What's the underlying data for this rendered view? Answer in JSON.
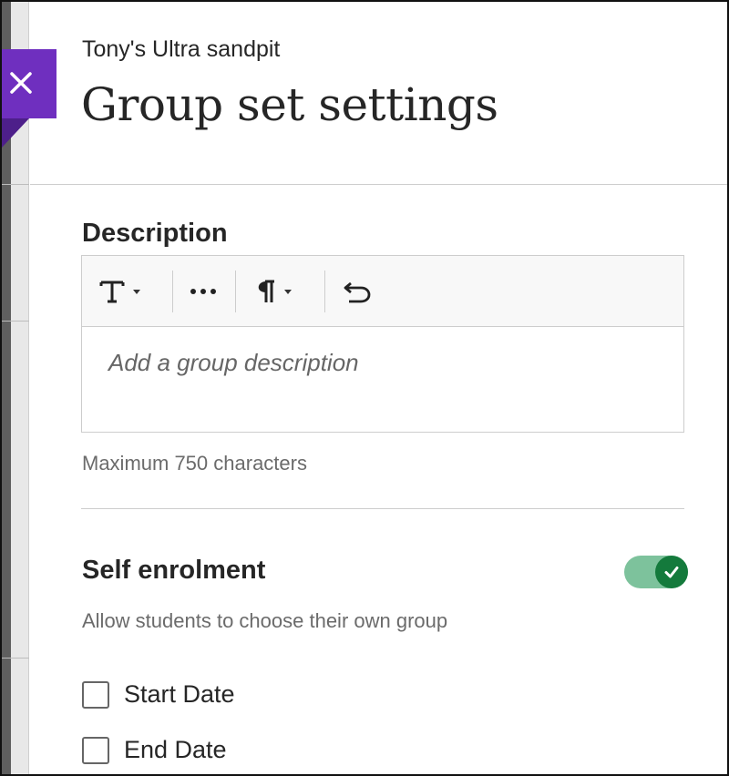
{
  "panel": {
    "course_name": "Tony's Ultra sandpit",
    "title": "Group set settings"
  },
  "description": {
    "label": "Description",
    "placeholder": "Add a group description",
    "helper": "Maximum 750 characters",
    "toolbar": {
      "text_style_icon": "text-format-icon",
      "more_icon": "more-options-icon",
      "paragraph_icon": "paragraph-icon",
      "undo_icon": "undo-icon"
    }
  },
  "self_enrolment": {
    "label": "Self enrolment",
    "description": "Allow students to choose their own group",
    "enabled": true,
    "toggle_on_color": "#147a3c",
    "toggle_track_color": "#7dc29c"
  },
  "dates": [
    {
      "label": "Start Date",
      "checked": false
    },
    {
      "label": "End Date",
      "checked": false
    }
  ],
  "colors": {
    "close_tab": "#6f2fbf",
    "close_tab_fold": "#4d1f8a"
  }
}
